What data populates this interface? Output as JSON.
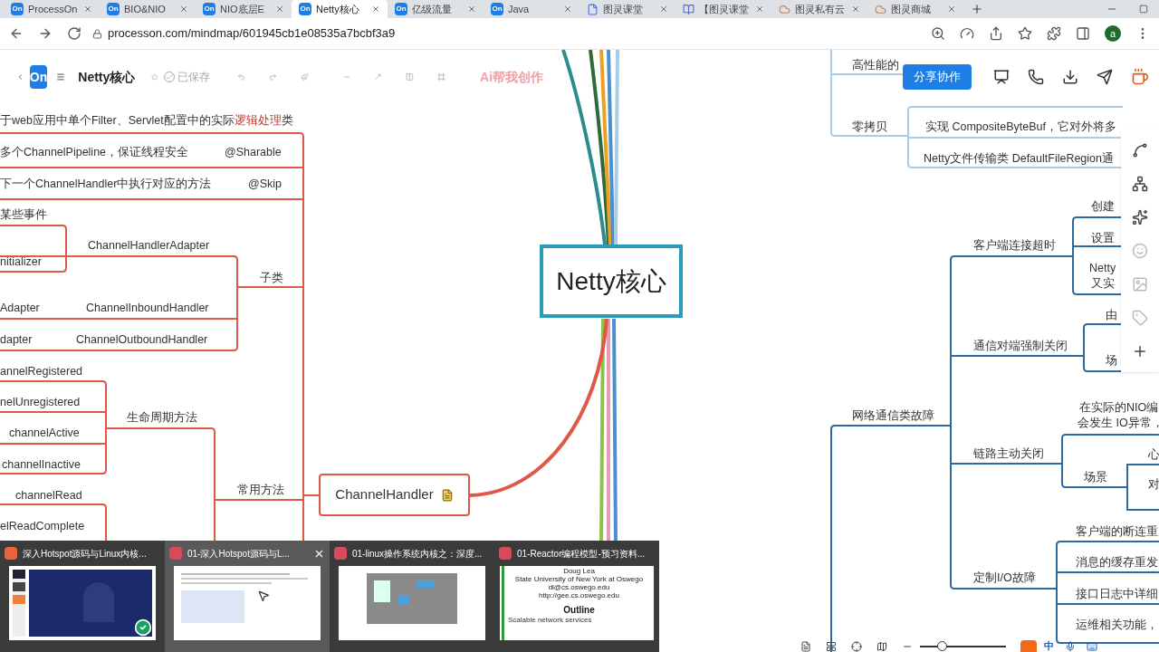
{
  "browser": {
    "tabs": [
      {
        "label": "ProcessOn",
        "badge": "On",
        "selected": false
      },
      {
        "label": "BIO&NIO",
        "badge": "On",
        "selected": false
      },
      {
        "label": "NIO底层E",
        "badge": "On",
        "selected": false
      },
      {
        "label": "Netty核心",
        "badge": "On",
        "selected": true
      },
      {
        "label": "亿级流量",
        "badge": "On",
        "selected": false
      },
      {
        "label": "Java",
        "badge": "On",
        "selected": false
      },
      {
        "label": "图灵课堂",
        "kind": "page",
        "selected": false
      },
      {
        "label": "【图灵课堂",
        "kind": "doc",
        "selected": false
      },
      {
        "label": "图灵私有云",
        "kind": "cloud",
        "selected": false
      },
      {
        "label": "图灵商城",
        "kind": "cloud",
        "selected": false
      }
    ],
    "url": "processon.com/mindmap/601945cb1e08535a7bcbf3a9",
    "profile_initial": "a"
  },
  "toolbar": {
    "logo": "On",
    "title": "Netty核心",
    "saved": "已保存",
    "ai": "Ai帮我创作",
    "share": "分享协作"
  },
  "mindmap": {
    "root": "Netty核心",
    "handler_node": "ChannelHandler",
    "left": [
      {
        "segments": [
          {
            "text": "于web应用中单个Filter、Servlet配置中的实际",
            "highlight": false
          },
          {
            "text": "逻辑处理",
            "highlight": true
          },
          {
            "text": "类",
            "highlight": false
          }
        ]
      },
      {
        "text": "多个ChannelPipeline，保证线程安全"
      },
      {
        "text": "@Sharable"
      },
      {
        "text": "下一个ChannelHandler中执行对应的方法"
      },
      {
        "text": "@Skip"
      },
      {
        "text": "某些事件"
      },
      {
        "text": "nitializer"
      },
      {
        "text": "ChannelHandlerAdapter"
      },
      {
        "text": "子类"
      },
      {
        "text": "Adapter"
      },
      {
        "text": "ChannelInboundHandler"
      },
      {
        "text": "dapter"
      },
      {
        "text": "ChannelOutboundHandler"
      },
      {
        "text": "annelRegistered"
      },
      {
        "text": "nelUnregistered"
      },
      {
        "text": "生命周期方法"
      },
      {
        "text": "channelActive"
      },
      {
        "text": "channelInactive"
      },
      {
        "text": "channelRead"
      },
      {
        "text": "常用方法"
      },
      {
        "text": "elReadComplete"
      }
    ],
    "right": [
      {
        "text": "高性能的"
      },
      {
        "text": "零拷贝"
      },
      {
        "text": "实现 CompositeByteBuf，它对外将多"
      },
      {
        "text": "Netty文件传输类 DefaultFileRegion通"
      },
      {
        "text": "创建"
      },
      {
        "text": "客户端连接超时"
      },
      {
        "text": "设置"
      },
      {
        "text": "Netty"
      },
      {
        "text": "又实"
      },
      {
        "text": "由"
      },
      {
        "text": "通信对端强制关闭"
      },
      {
        "text": "场"
      },
      {
        "text": "网络通信类故障"
      },
      {
        "text": "在实际的NIO编"
      },
      {
        "text": "会发生 IO异常，"
      },
      {
        "text": "链路主动关闭"
      },
      {
        "text": "心"
      },
      {
        "text": "场景"
      },
      {
        "text": "对"
      },
      {
        "text": "客户端的断连重"
      },
      {
        "text": "消息的缓存重发"
      },
      {
        "text": "定制I/O故障"
      },
      {
        "text": "接口日志中详细"
      },
      {
        "text": "运维相关功能，"
      }
    ]
  },
  "status": {
    "zoom": {
      "level": 0.25
    },
    "ime": "中"
  },
  "taskbar_preview": {
    "items": [
      {
        "title": "深入Hotspot源码与Linux内核...",
        "kind": "slides",
        "selected": false
      },
      {
        "title": "01-深入Hotspot源码与L...",
        "kind": "document",
        "selected": true
      },
      {
        "title": "01-linux操作系统内核之：深度...",
        "kind": "diagram",
        "selected": false
      },
      {
        "title": "01-Reactor编程模型-预习资料...",
        "kind": "outline",
        "selected": false,
        "lines": [
          "Doug Lea",
          "State University of New York at Oswego",
          "dl@cs.oswego.edu",
          "http://gee.cs.oswego.edu"
        ],
        "heading": "Outline",
        "bullet": "Scalable network services"
      }
    ]
  }
}
